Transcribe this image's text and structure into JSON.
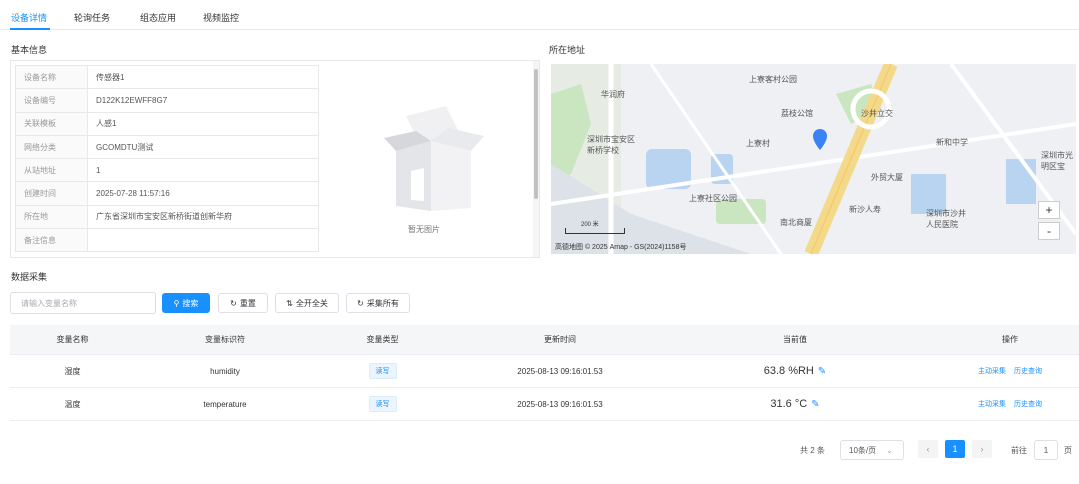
{
  "tabs": [
    "设备详情",
    "轮询任务",
    "组态应用",
    "视频监控"
  ],
  "basic_title": "基本信息",
  "location_title": "所在地址",
  "device_info": [
    {
      "label": "设备名称",
      "value": "传感器1"
    },
    {
      "label": "设备编号",
      "value": "D122K12EWFF8G7"
    },
    {
      "label": "关联模板",
      "value": "人感1"
    },
    {
      "label": "网络分类",
      "value": "GCOMDTU测试"
    },
    {
      "label": "从站地址",
      "value": "1"
    },
    {
      "label": "创建时间",
      "value": "2025-07-28 11:57:16"
    },
    {
      "label": "所在地",
      "value": "广东省深圳市宝安区新桥街道创新华府"
    },
    {
      "label": "备注信息",
      "value": ""
    }
  ],
  "no_image_text": "暂无图片",
  "map": {
    "labels": {
      "park": "上寮客村公园",
      "huaxi": "华润府",
      "school": "深圳市宝安区\n新桥学校",
      "xiansheng": "荔枝公馆",
      "shangzhai": "上寮村",
      "shajing": "沙井立交",
      "xinlong": "新和中学",
      "shenzhen": "深圳市光\n明区宝",
      "shangliao_park": "上寮社区公园",
      "center": "外贸大厦",
      "nanbei": "南北商厦",
      "xinyi": "新沙人寿",
      "hospital": "深圳市沙井\n人民医院"
    },
    "scale": "200 米",
    "attribution": "高德地图  © 2025 Amap - GS(2024)1158号",
    "zoom_in": "+",
    "zoom_out": "-"
  },
  "data_title": "数据采集",
  "search": {
    "placeholder": "请输入变量名称"
  },
  "buttons": {
    "search": "搜索",
    "reset": "重置",
    "toggle_all": "全开全关",
    "collect_all": "采集所有"
  },
  "table": {
    "headers": [
      "变量名称",
      "变量标识符",
      "变量类型",
      "更新时间",
      "当前值",
      "操作"
    ],
    "rows": [
      {
        "name": "湿度",
        "identifier": "humidity",
        "type": "读写",
        "time": "2025-08-13 09:16:01.53",
        "value": "63.8 %RH",
        "actions": [
          "主动采集",
          "历史查询"
        ]
      },
      {
        "name": "温度",
        "identifier": "temperature",
        "type": "读写",
        "time": "2025-08-13 09:16:01.53",
        "value": "31.6 °C",
        "actions": [
          "主动采集",
          "历史查询"
        ]
      }
    ]
  },
  "pagination": {
    "total": "共 2 条",
    "page_size": "10条/页",
    "current": "1",
    "goto_label": "前往",
    "goto_value": "1",
    "page_unit": "页"
  },
  "colors": {
    "primary": "#1890ff",
    "road": "#f5d98a",
    "water": "#b8d4f0",
    "green": "#c9e6c0"
  }
}
